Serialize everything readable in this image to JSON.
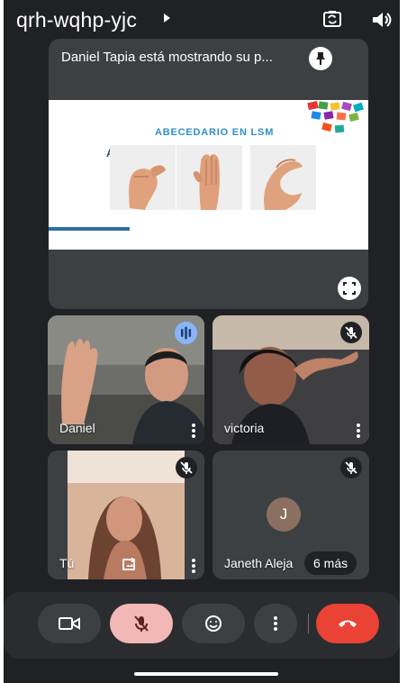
{
  "topbar": {
    "meeting_code": "qrh-wqhp-yjc",
    "icons": [
      "chevron-right-icon",
      "switch-camera-icon",
      "speaker-icon"
    ]
  },
  "presentation": {
    "status": "Daniel Tapia está mostrando su p...",
    "slide_title": "ABECEDARIO EN LSM",
    "letters": [
      "A",
      "B",
      "C"
    ],
    "icons": [
      "pin-icon",
      "fullscreen-icon"
    ]
  },
  "participants": [
    {
      "name": "Daniel",
      "status_icon": "speaking-icon"
    },
    {
      "name": "victoria",
      "status_icon": "mic-off-icon"
    },
    {
      "name": "Tú",
      "status_icon": "mic-off-icon",
      "extra_icon": "frame-icon"
    },
    {
      "name": "Janeth Aleja",
      "initial": "J",
      "more": "6 más",
      "status_icon": "mic-off-icon"
    }
  ],
  "controls": [
    {
      "icon": "camera-icon"
    },
    {
      "icon": "mic-off-icon"
    },
    {
      "icon": "emoji-icon"
    },
    {
      "icon": "more-icon"
    },
    {
      "icon": "end-call-icon"
    }
  ],
  "colors": {
    "background": "#202124",
    "tile": "#3c4043",
    "accent": "#8ab4f8",
    "muted_button": "#f2b8b5",
    "end_call": "#ea4335",
    "slide_title": "#2e8fc7"
  }
}
